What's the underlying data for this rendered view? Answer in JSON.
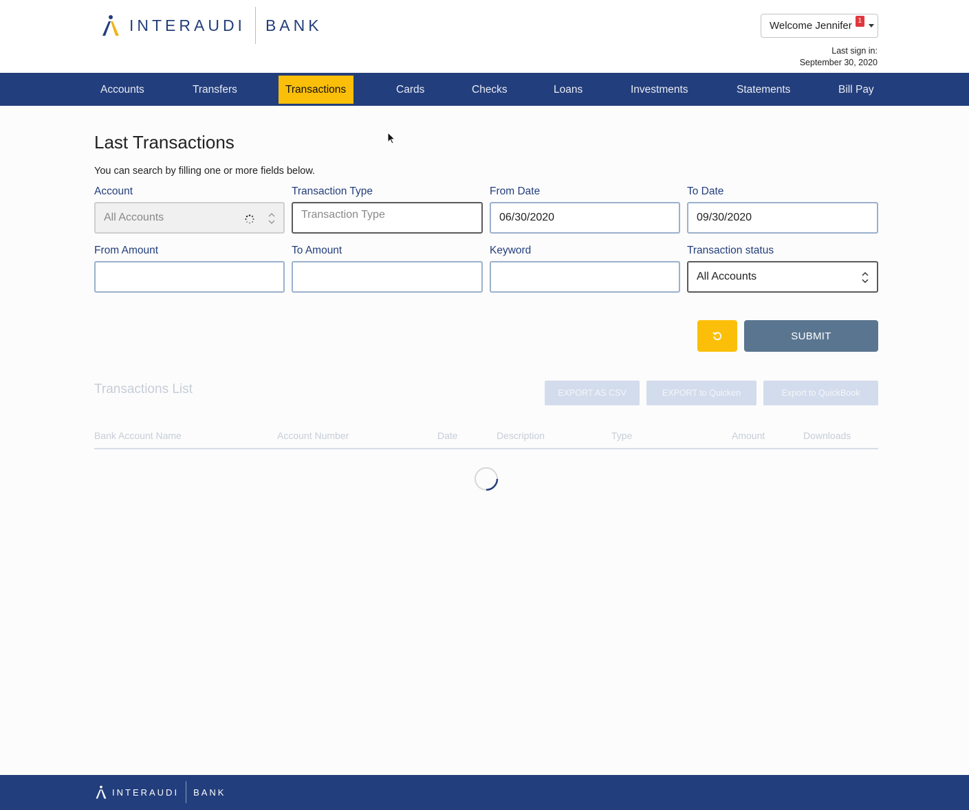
{
  "brand": {
    "name_left": "INTERAUDI",
    "name_right": "BANK",
    "accent": "#fbbf0a",
    "primary": "#233e7c"
  },
  "user": {
    "welcome": "Welcome Jennifer",
    "notifications": "1",
    "last_sign_label": "Last sign in:",
    "last_sign_date": "September 30, 2020"
  },
  "nav": {
    "items": [
      "Accounts",
      "Transfers",
      "Transactions",
      "Cards",
      "Checks",
      "Loans",
      "Investments",
      "Statements",
      "Bill Pay"
    ],
    "active": "Transactions"
  },
  "main": {
    "title": "Last Transactions",
    "hint": "You can search by filling one or more fields below.",
    "fields": {
      "account": {
        "label": "Account",
        "value": "All Accounts"
      },
      "transaction_type": {
        "label": "Transaction Type",
        "placeholder": "Transaction Type"
      },
      "from_date": {
        "label": "From Date",
        "value": "06/30/2020"
      },
      "to_date": {
        "label": "To Date",
        "value": "09/30/2020"
      },
      "from_amount": {
        "label": "From Amount",
        "value": ""
      },
      "to_amount": {
        "label": "To Amount",
        "value": ""
      },
      "keyword": {
        "label": "Keyword",
        "value": ""
      },
      "status": {
        "label": "Transaction status",
        "value": "All Accounts"
      }
    },
    "submit_label": "SUBMIT",
    "reset_icon": "refresh-icon"
  },
  "list": {
    "title": "Transactions List",
    "export_csv": "EXPORT AS CSV",
    "export_quicken": "EXPORT to Quicken",
    "export_quickbook": "Export to QuickBook",
    "columns": [
      "Bank Account Name",
      "Account Number",
      "Date",
      "Description",
      "Type",
      "Amount",
      "Downloads"
    ]
  },
  "footer": {
    "name_left": "INTERAUDI",
    "name_right": "BANK"
  }
}
